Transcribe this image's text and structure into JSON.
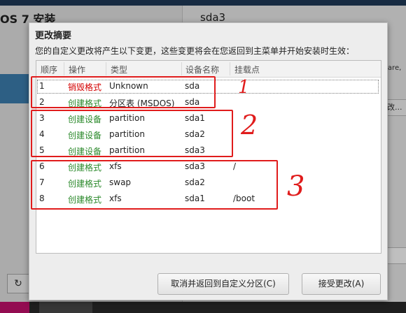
{
  "background": {
    "window_title": "OS 7 安装",
    "right_title": "sda3",
    "right_partial_text": "vare,",
    "right_partial_button": "改..."
  },
  "dialog": {
    "title": "更改摘要",
    "description": "您的自定义更改将产生以下变更，这些变更将会在您返回到主菜单并开始安装时生效：",
    "columns": [
      "顺序",
      "操作",
      "类型",
      "设备名称",
      "挂载点"
    ],
    "rows": [
      {
        "order": "1",
        "action": "销毁格式",
        "action_kind": "destroy",
        "type": "Unknown",
        "device": "sda",
        "mount": ""
      },
      {
        "order": "2",
        "action": "创建格式",
        "action_kind": "create",
        "type": "分区表 (MSDOS)",
        "device": "sda",
        "mount": ""
      },
      {
        "order": "3",
        "action": "创建设备",
        "action_kind": "create",
        "type": "partition",
        "device": "sda1",
        "mount": ""
      },
      {
        "order": "4",
        "action": "创建设备",
        "action_kind": "create",
        "type": "partition",
        "device": "sda2",
        "mount": ""
      },
      {
        "order": "5",
        "action": "创建设备",
        "action_kind": "create",
        "type": "partition",
        "device": "sda3",
        "mount": ""
      },
      {
        "order": "6",
        "action": "创建格式",
        "action_kind": "create",
        "type": "xfs",
        "device": "sda3",
        "mount": "/"
      },
      {
        "order": "7",
        "action": "创建格式",
        "action_kind": "create",
        "type": "swap",
        "device": "sda2",
        "mount": ""
      },
      {
        "order": "8",
        "action": "创建格式",
        "action_kind": "create",
        "type": "xfs",
        "device": "sda1",
        "mount": "/boot"
      }
    ],
    "cancel_button": "取消并返回到自定义分区(C)",
    "accept_button": "接受更改(A)"
  },
  "annotations": [
    "1",
    "2",
    "3"
  ],
  "colors": {
    "destroy": "#d40000",
    "create": "#2c8a2c",
    "annotation": "#e01c1c"
  }
}
